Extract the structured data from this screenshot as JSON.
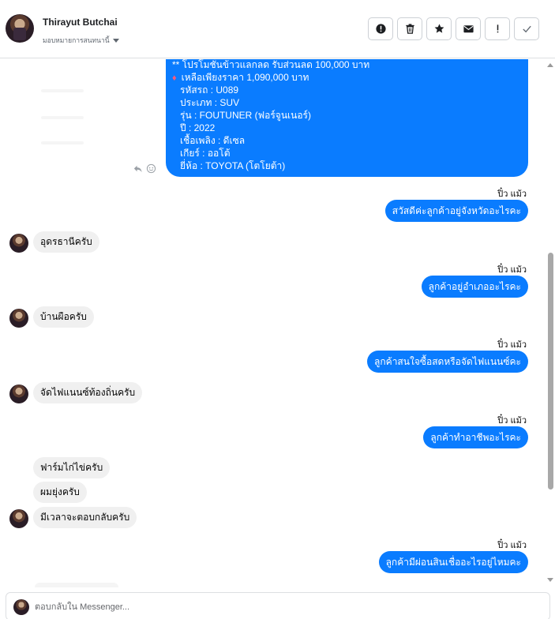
{
  "header": {
    "contact_name": "Thirayut Butchai",
    "assign_label": "มอบหมายการสนทนานี้"
  },
  "actions": [
    {
      "name": "spam-button",
      "icon": "exclamation-circle-icon"
    },
    {
      "name": "delete-button",
      "icon": "trash-icon"
    },
    {
      "name": "star-button",
      "icon": "star-icon"
    },
    {
      "name": "mark-unread-button",
      "icon": "envelope-icon"
    },
    {
      "name": "follow-up-button",
      "icon": "exclamation-icon"
    },
    {
      "name": "mark-done-button",
      "icon": "checkmark-icon"
    }
  ],
  "product_message": {
    "promo": "** โปรโมชั่นข้าวแลกลด รับส่วนลด 100,000 บาท",
    "price": "เหลือเพียงราคา 1,090,000 บาท",
    "code": "รหัสรถ : U089",
    "type": "ประเภท : SUV",
    "model": "รุ่น : FOUTUNER (ฟอร์จูนเนอร์)",
    "year": "ปี : 2022",
    "fuel": "เชื้อเพลิง : ดีเซล",
    "gear": "เกียร์ : ออโต้",
    "brand": "ยี่ห้อ : TOYOTA (โตโยต้า)"
  },
  "messages": {
    "sender_1": "ปิ๋ว แม้ว",
    "out_1": "สวัสดีค่ะลูกค้าอยู่จังหวัดอะไรคะ",
    "in_1": "อุดรธานีครับ",
    "sender_2": "ปิ๋ว แม้ว",
    "out_2": "ลูกค้าอยู่อำเภออะไรคะ",
    "in_2": "บ้านผือครับ",
    "sender_3": "ปิ๋ว แม้ว",
    "out_3": "ลูกค้าสนใจซื้อสดหรือจัดไฟแนนซ์คะ",
    "in_3": "จัดไฟแนนซ์ท้องถิ่นครับ",
    "sender_4": "ปิ๋ว แม้ว",
    "out_4": "ลูกค้าทำอาชีพอะไรคะ",
    "in_4a": "ฟาร์มไก่ไข่ครับ",
    "in_4b": "ผมยุ่งครับ",
    "in_4c": "มีเวลาจะตอบกลับครับ",
    "sender_5": "ปิ๋ว แม้ว",
    "out_5": "ลูกค้ามีผ่อนสินเชื่ออะไรอยู่ไหมคะ"
  },
  "reply": {
    "placeholder": "ตอบกลับใน Messenger..."
  },
  "colors": {
    "outgoing_bubble": "#0a7cff",
    "incoming_bubble": "#f0f0f0"
  }
}
